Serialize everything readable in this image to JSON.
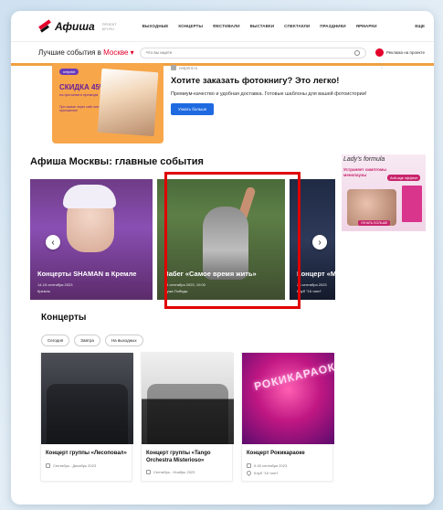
{
  "header": {
    "logo_text": "Афиша",
    "logo_sub": "ПРОЕКТ AFI.RU",
    "nav": [
      "ВЫХОДНЫЕ",
      "КОНЦЕРТЫ",
      "ФЕСТИВАЛИ",
      "ВЫСТАВКИ",
      "СПЕКТАКЛИ",
      "ПРАЗДНИКИ",
      "ЯРМАРКИ"
    ],
    "more": "ЕЩЕ"
  },
  "searchbar": {
    "best_label": "Лучшие события в",
    "city": "Москве",
    "placeholder": "Что вы ищете",
    "promo_label": "Реклама на проекте"
  },
  "ad": {
    "brand": "netprint",
    "sale_title": "СКИДКА 45%",
    "sale_sub": "на фотокниги премиум",
    "sale_note": "При заказе через сайт или приложение",
    "source": "netprint.ru",
    "title": "Хотите заказать фотокнигу? Это легко!",
    "description": "Премиум-качество и удобная доставка. Готовые шаблоны для вашей фотоистории!",
    "button": "Узнать больше"
  },
  "main_title": "Афиша Москвы: главные события",
  "slides": [
    {
      "title": "Концерты SHAMAN в Кремле",
      "date": "14-15 сентября 2023",
      "place": "Кремль"
    },
    {
      "title": "Забег «Самое время жить»",
      "date": "24 сентября 2023, 10:00",
      "place": "Лужа Победы"
    },
    {
      "title": "Концерт «Маро",
      "date": "23 сентября 2023",
      "place": "Клуб \"16 тонн\""
    }
  ],
  "side_ad": {
    "brand": "Lady's formula",
    "claim": "Устраняет симптомы менопаузы",
    "badge": "Anti-age эффект",
    "buy": "УЗНАТЬ БОЛЬШЕ"
  },
  "concerts": {
    "title": "Концерты",
    "chips": [
      "Сегодня",
      "Завтра",
      "На выходных"
    ],
    "cards": [
      {
        "title": "Концерт группы «Лесоповал»",
        "date": "Сентябрь - Декабрь 2023",
        "place": ""
      },
      {
        "title": "Концерт группы «Tango Orchestra Misterioso»",
        "date": "Сентябрь - Ноябрь 2023",
        "place": ""
      },
      {
        "title": "Концерт Рокикараоке",
        "date": "9-30 сентября 2023",
        "place": "Клуб \"16 тонн\"",
        "neon": "РОКИКАРАОКЕ"
      }
    ]
  },
  "colors": {
    "brand_red": "#e4002b",
    "highlight": "#e00000",
    "accent_orange": "#f0a040",
    "button_blue": "#1f6ae0"
  }
}
